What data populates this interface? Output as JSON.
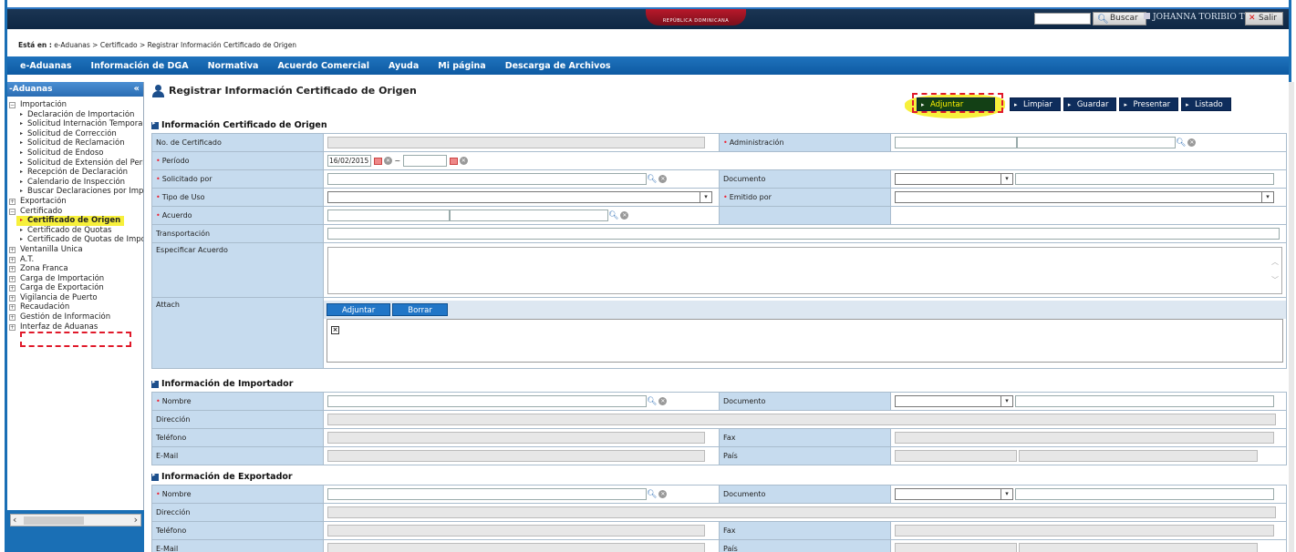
{
  "topbar": {
    "logo_text": "REPÚBLICA DOMINICANA",
    "buscar_label": "Buscar",
    "user_name": "JOHANNA TORIBIO TORIBIO",
    "salir_label": "Salir"
  },
  "breadcrumb": {
    "prefix": "Está en :",
    "path": "e-Aduanas > Certificado > Registrar Información Certificado de Origen"
  },
  "nav": [
    "e-Aduanas",
    "Información de DGA",
    "Normativa",
    "Acuerdo Comercial",
    "Ayuda",
    "Mi página",
    "Descarga de Archivos"
  ],
  "sidebar": {
    "title": "-Aduanas",
    "collapse": "«",
    "items": [
      {
        "label": "Importación",
        "level": 1,
        "toggle": "−"
      },
      {
        "label": "Declaración de Importación",
        "level": 2
      },
      {
        "label": "Solicitud Internación Temporal",
        "level": 2
      },
      {
        "label": "Solicitud de Corrección",
        "level": 2
      },
      {
        "label": "Solicitud de Reclamación",
        "level": 2
      },
      {
        "label": "Solicitud de Endoso",
        "level": 2
      },
      {
        "label": "Solicitud de Extensión del Período",
        "level": 2
      },
      {
        "label": "Recepción de Declaración",
        "level": 2
      },
      {
        "label": "Calendario de Inspección",
        "level": 2
      },
      {
        "label": "Buscar Declaraciones por Importador",
        "level": 2
      },
      {
        "label": "Exportación",
        "level": 1,
        "toggle": "+"
      },
      {
        "label": "Certificado",
        "level": 1,
        "toggle": "−"
      },
      {
        "label": "Certificado de Origen",
        "level": 2,
        "active": true
      },
      {
        "label": "Certificado de Quotas",
        "level": 2
      },
      {
        "label": "Certificado de Quotas de Importación",
        "level": 2
      },
      {
        "label": "Ventanilla Única",
        "level": 1,
        "toggle": "+"
      },
      {
        "label": "A.T.",
        "level": 1,
        "toggle": "+"
      },
      {
        "label": "Zona Franca",
        "level": 1,
        "toggle": "+"
      },
      {
        "label": "Carga de Importación",
        "level": 1,
        "toggle": "+"
      },
      {
        "label": "Carga de Exportación",
        "level": 1,
        "toggle": "+"
      },
      {
        "label": "Vigilancia de Puerto",
        "level": 1,
        "toggle": "+"
      },
      {
        "label": "Recaudación",
        "level": 1,
        "toggle": "+"
      },
      {
        "label": "Gestión de Información",
        "level": 1,
        "toggle": "+"
      },
      {
        "label": "Interfaz de Aduanas",
        "level": 1,
        "toggle": "+"
      }
    ]
  },
  "page": {
    "title": "Registrar Información Certificado de Origen"
  },
  "toolbar": {
    "adjuntar": "Adjuntar",
    "limpiar": "Limpiar",
    "guardar": "Guardar",
    "presentar": "Presentar",
    "listado": "Listado"
  },
  "cert_section": {
    "title": "Información Certificado de Origen",
    "no_certificado": "No. de Certificado",
    "administracion": "Administración",
    "periodo": "Período",
    "periodo_from": "16/02/2015",
    "periodo_sep": "~",
    "solicitado_por": "Solicitado por",
    "documento": "Documento",
    "tipo_uso": "Tipo de Uso",
    "emitido_por": "Emitido por",
    "acuerdo": "Acuerdo",
    "transportacion": "Transportación",
    "especificar_acuerdo": "Especificar Acuerdo",
    "attach": "Attach",
    "attach_adjuntar": "Adjuntar",
    "attach_borrar": "Borrar"
  },
  "importador_section": {
    "title": "Información de Importador",
    "nombre": "Nombre",
    "documento": "Documento",
    "direccion": "Dirección",
    "telefono": "Teléfono",
    "fax": "Fax",
    "email": "E-Mail",
    "pais": "País"
  },
  "exportador_section": {
    "title": "Información de Exportador",
    "nombre": "Nombre",
    "documento": "Documento",
    "direccion": "Dirección",
    "telefono": "Teléfono",
    "fax": "Fax",
    "email": "E-Mail",
    "pais": "País"
  },
  "colors": {
    "nav_blue": "#1f73bd",
    "label_cell": "#c6dbee",
    "highlight_yellow": "#f7f03b",
    "highlight_red": "#e0192a"
  }
}
